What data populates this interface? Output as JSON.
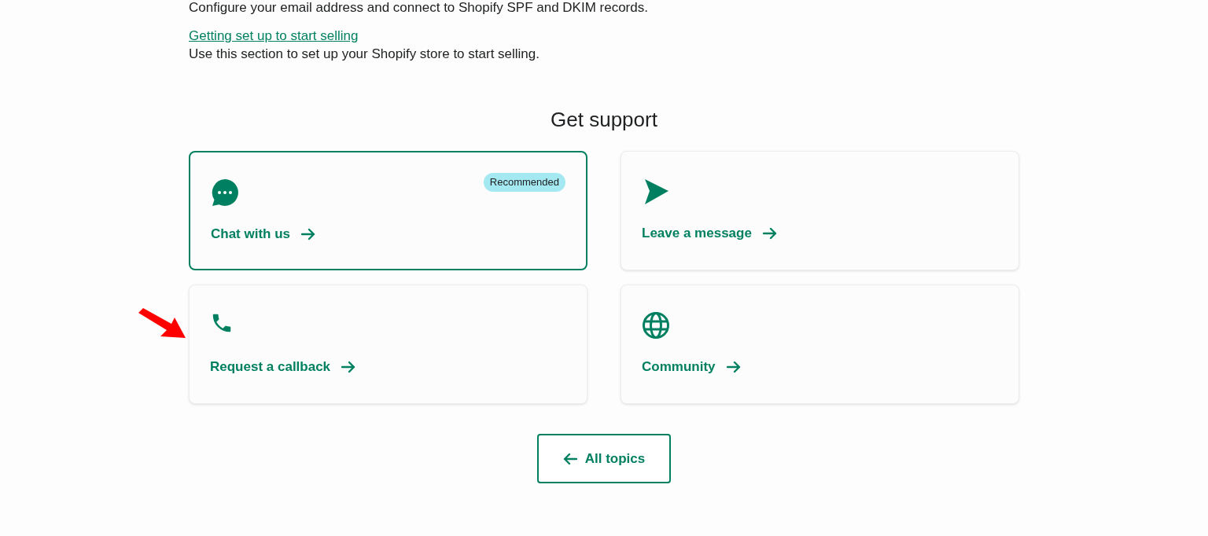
{
  "intro": {
    "text": "Configure your email address and connect to Shopify SPF and DKIM records."
  },
  "section_link": {
    "label": "Getting set up to start selling",
    "description": "Use this section to set up your Shopify store to start selling."
  },
  "support": {
    "title": "Get support",
    "options": [
      {
        "label": "Chat with us",
        "kind": "chat",
        "badge": "Recommended",
        "selected": true
      },
      {
        "label": "Leave a message",
        "kind": "send",
        "selected": false
      },
      {
        "label": "Request a callback",
        "kind": "phone",
        "selected": false,
        "annotated": true
      },
      {
        "label": "Community",
        "kind": "globe",
        "selected": false
      }
    ]
  },
  "back_button": {
    "label": "All topics"
  }
}
